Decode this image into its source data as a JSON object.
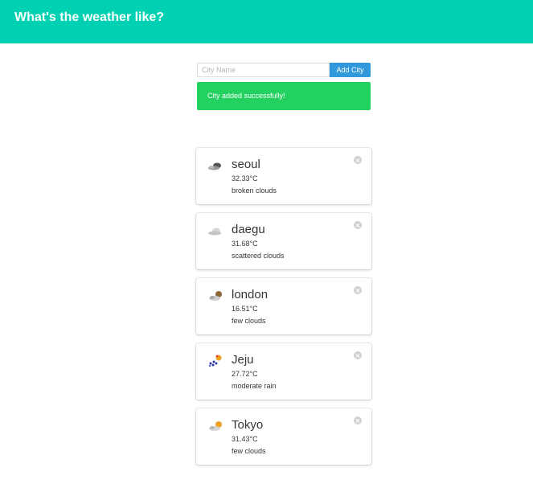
{
  "header": {
    "title": "What's the weather like?"
  },
  "form": {
    "placeholder": "City Name",
    "value": "",
    "add_label": "Add City"
  },
  "notification": {
    "message": "City added successfully!",
    "color": "#23d160"
  },
  "cities": [
    {
      "name": "seoul",
      "temp": "32.33°C",
      "description": "broken clouds",
      "icon": "broken-clouds-icon"
    },
    {
      "name": "daegu",
      "temp": "31.68°C",
      "description": "scattered clouds",
      "icon": "scattered-clouds-icon"
    },
    {
      "name": "london",
      "temp": "16.51°C",
      "description": "few clouds",
      "icon": "few-clouds-icon"
    },
    {
      "name": "Jeju",
      "temp": "27.72°C",
      "description": "moderate rain",
      "icon": "moderate-rain-icon"
    },
    {
      "name": "Tokyo",
      "temp": "31.43°C",
      "description": "few clouds",
      "icon": "few-clouds-icon"
    }
  ],
  "colors": {
    "header": "#00d1b2",
    "add_button": "#3298dc",
    "success": "#23d160"
  }
}
